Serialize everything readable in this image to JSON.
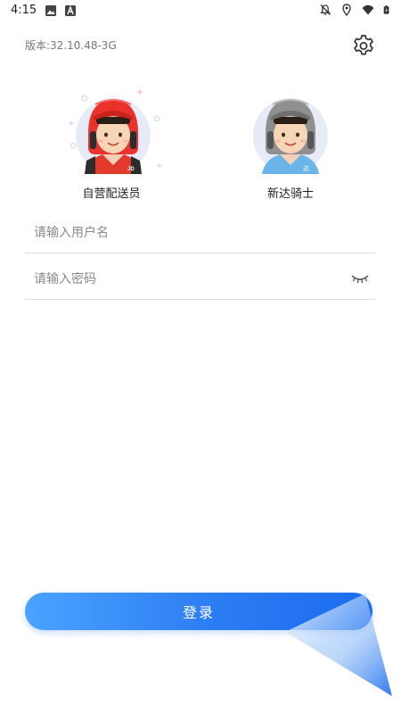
{
  "status_bar": {
    "time": "4:15",
    "left_icons": [
      "image-icon",
      "font-icon"
    ],
    "right_icons": [
      "notification-off-icon",
      "location-icon",
      "wifi-icon",
      "battery-icon"
    ]
  },
  "header": {
    "version": "版本:32.10.48-3G",
    "settings_icon": "gear-icon"
  },
  "roles": [
    {
      "label": "自营配送员",
      "helmet_color": "#e8322b",
      "shirt_color": "#e23a2d",
      "badge": "JD",
      "selected": true
    },
    {
      "label": "新达骑士",
      "helmet_color": "#8f8f8f",
      "shirt_color": "#6bb4ea",
      "badge": "达",
      "selected": false
    }
  ],
  "form": {
    "username": {
      "placeholder": "请输入用户名",
      "value": ""
    },
    "password": {
      "placeholder": "请输入密码",
      "value": "",
      "toggle_icon": "eye-closed-icon"
    }
  },
  "login": {
    "label": "登录"
  },
  "colors": {
    "accent": "#2c7cf3",
    "accent_light": "#4aa3ff",
    "divider": "#dcdcdc"
  }
}
